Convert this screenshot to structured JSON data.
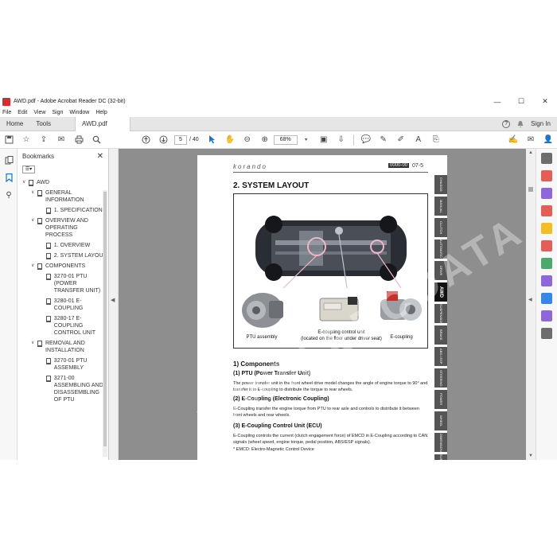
{
  "window": {
    "title": "AWD.pdf - Adobe Acrobat Reader DC (32-bit)",
    "minimize": "—",
    "maximize": "☐",
    "close": "✕"
  },
  "menu": [
    "File",
    "Edit",
    "View",
    "Sign",
    "Window",
    "Help"
  ],
  "tabs": {
    "home": "Home",
    "tools": "Tools",
    "document": "AWD.pdf",
    "close": "×",
    "help": "?",
    "sign_in": "Sign In"
  },
  "toolbar": {
    "page_current": "5",
    "page_total": "/ 40",
    "zoom": "68%"
  },
  "bookmarks": {
    "title": "Bookmarks",
    "close": "✕",
    "items": [
      {
        "label": "AWD",
        "level": 0,
        "expandable": true
      },
      {
        "label": "GENERAL INFORMATION",
        "level": 1,
        "expandable": true
      },
      {
        "label": "1. SPECIFICATION",
        "level": 2,
        "expandable": false
      },
      {
        "label": "OVERVIEW AND OPERATING PROCESS",
        "level": 1,
        "expandable": true
      },
      {
        "label": "1. OVERVIEW",
        "level": 2,
        "expandable": false
      },
      {
        "label": "2. SYSTEM LAYOUT",
        "level": 2,
        "expandable": false
      },
      {
        "label": "COMPONENTS",
        "level": 1,
        "expandable": true
      },
      {
        "label": "3270-01 PTU (POWER TRANSFER UNIT)",
        "level": 2,
        "expandable": false
      },
      {
        "label": "3280-01 E-COUPLING",
        "level": 2,
        "expandable": false
      },
      {
        "label": "3280-17 E-COUPLING CONTROL UNIT",
        "level": 2,
        "expandable": false
      },
      {
        "label": "REMOVAL AND INSTALLATION",
        "level": 1,
        "expandable": true
      },
      {
        "label": "3270-01 PTU ASSEMBLY",
        "level": 2,
        "expandable": false
      },
      {
        "label": "3271-00 ASSEMBLING AND DISASSEMBLING OF PTU",
        "level": 2,
        "expandable": false
      }
    ]
  },
  "document": {
    "brand": "korando",
    "code": "0000-00",
    "page_number": "07-5",
    "heading": "2. SYSTEM LAYOUT",
    "figure_captions": {
      "ptu": "PTU assembly",
      "ecu": "E-coupling control unit\n(located on the floor under driver seat)",
      "ecoupling": "E-coupling"
    },
    "side_tabs": [
      "CHASSIS SYSTEM",
      "MANUAL TRANS",
      "CLUTCH",
      "AUTOMATIC TRANS",
      "DRIVE SHAFT",
      "AWD",
      "SUSPENSION",
      "BRAKE SYSTEM",
      "ABS / ESP",
      "STEERING",
      "POWER STEERING",
      "WHEEL",
      "DIMENSION",
      "SUBSYSTEM"
    ],
    "active_side_tab": "AWD",
    "components_heading": "1) Components",
    "sections": [
      {
        "title": "(1) PTU (Power Transfer Unit)",
        "body": "The power transfer unit in the front wheel drive model changes the angle of engine torque to 90° and transfer it to E-coupling to distribute the torque to rear wheels."
      },
      {
        "title": "(2) E-Coupling (Electronic Coupling)",
        "body": "E-Coupling transfer the engine torque from PTU to rear axle and controls to distribute it between front wheels and rear wheels."
      },
      {
        "title": "(3) E-Coupling Control Unit (ECU)",
        "body": "E-Coupling controls the current (clutch engagement force) of EMCD in E-Coupling according to CAN signals (wheel speed, engine torque, pedal position, ABS/ESP signals).",
        "note": "* EMCD: Electro-Magnetic Control Device"
      }
    ],
    "watermark": "WWW.EPCDATA.COM"
  },
  "icons": {
    "left_rail": [
      "pages-icon",
      "bookmark-icon",
      "attachment-icon"
    ],
    "right_rail": [
      "zoom-icon",
      "export-pdf-icon",
      "organize-icon",
      "create-pdf-icon",
      "comment-icon",
      "edit-pdf-icon",
      "scan-icon",
      "fill-sign-icon",
      "protect-icon",
      "pen-icon",
      "more-tools-icon"
    ]
  },
  "colors": {
    "accent": "#1473e6",
    "title_icon": "#d32f2f"
  }
}
